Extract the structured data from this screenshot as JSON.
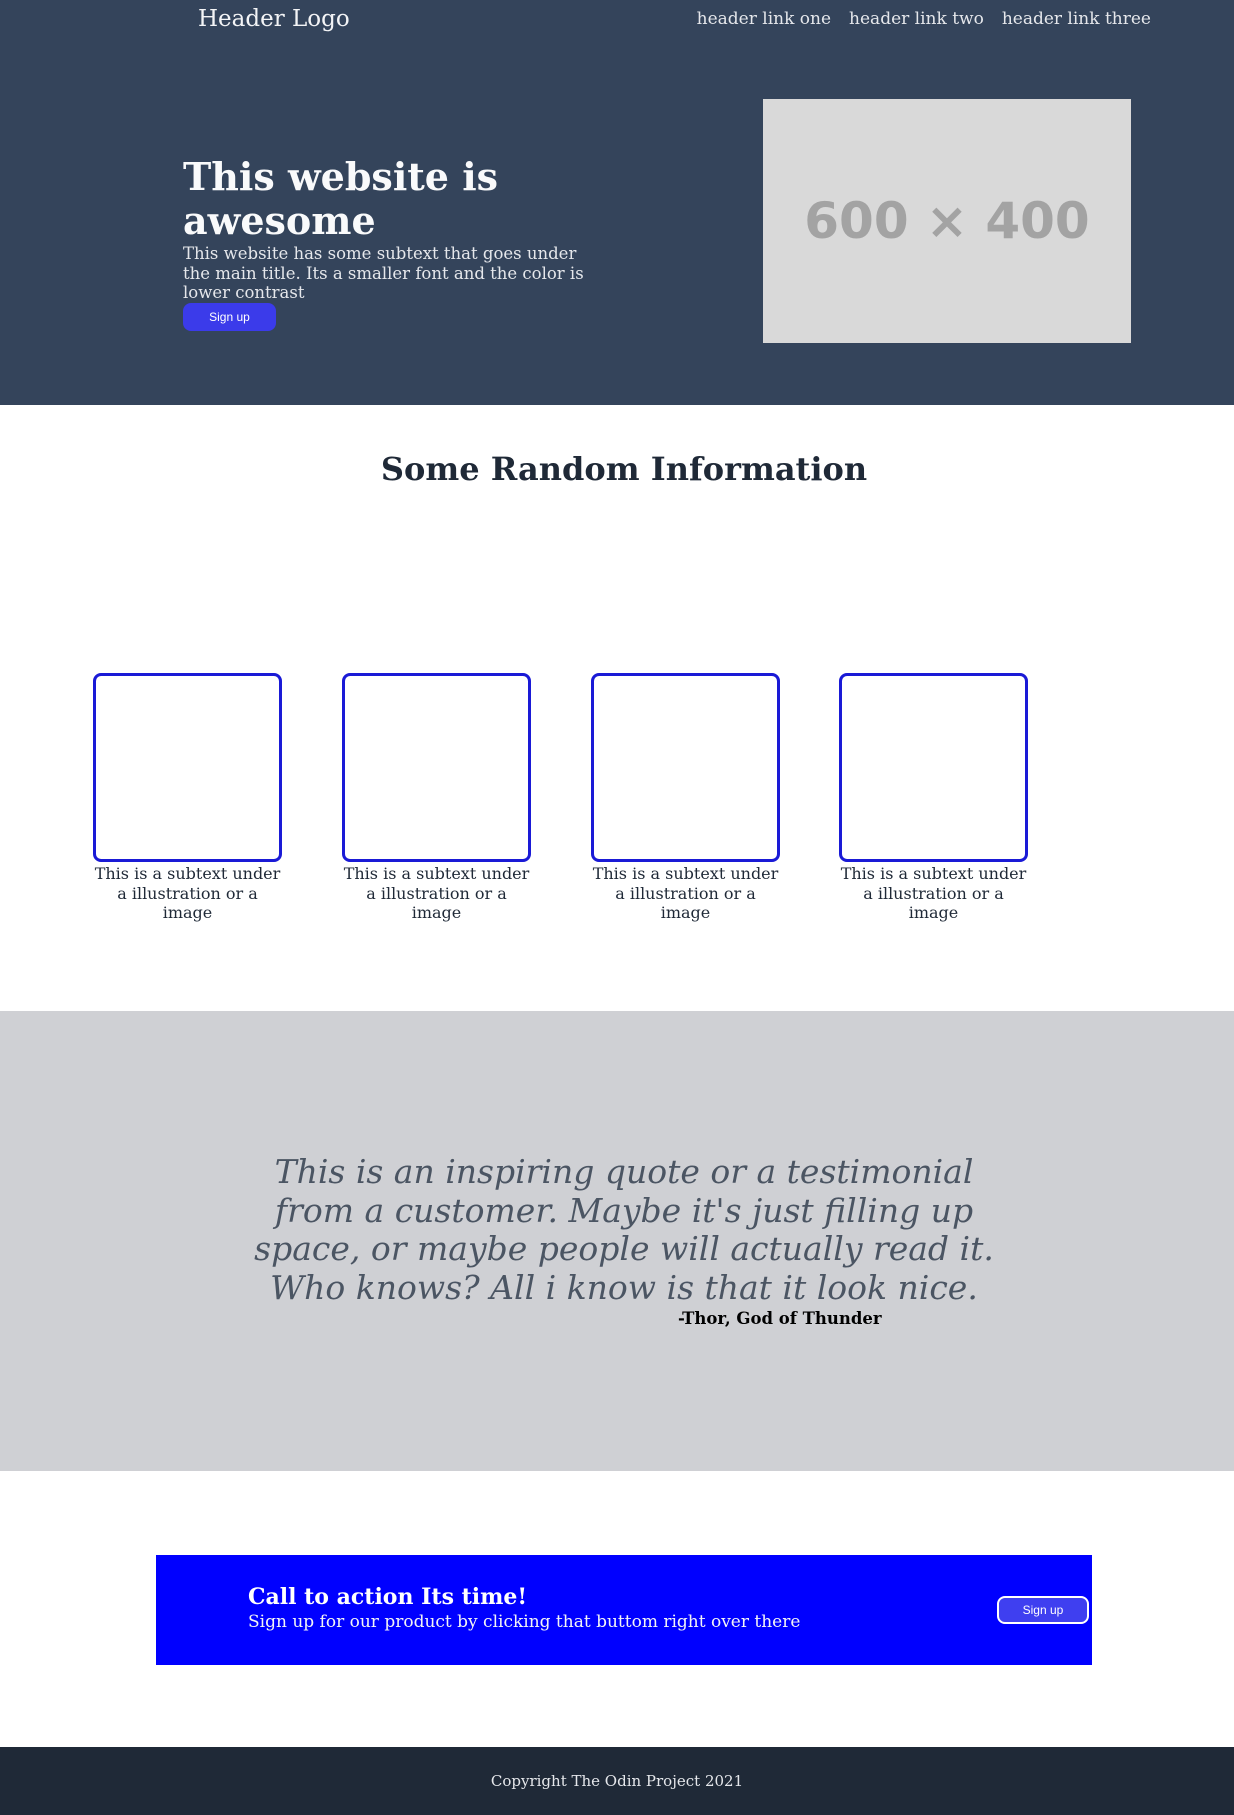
{
  "header": {
    "logo": "Header Logo",
    "links": [
      "header link one",
      "header link two",
      "header link three"
    ]
  },
  "hero": {
    "title": "This website is awesome",
    "subtitle": "This website has some subtext that goes under the main title. Its a smaller font and the color is lower contrast",
    "button_label": "Sign up",
    "image_placeholder": "600 × 400"
  },
  "info": {
    "title": "Some Random Information",
    "cards": [
      {
        "text": "This is a subtext under a illustration or a image"
      },
      {
        "text": "This is a subtext under a illustration or a image"
      },
      {
        "text": "This is a subtext under a illustration or a image"
      },
      {
        "text": "This is a subtext under a illustration or a image"
      }
    ]
  },
  "quote": {
    "text": "This is an inspiring quote or a testimonial from a customer. Maybe it's just filling up space, or maybe people will actually read it. Who knows? All i know is that it look nice.",
    "author": "-Thor, God of Thunder"
  },
  "cta": {
    "title": "Call to action Its time!",
    "subtitle": "Sign up for our product by clicking that buttom right over there",
    "button_label": "Sign up"
  },
  "footer": {
    "text": "Copyright The Odin Project 2021"
  },
  "colors": {
    "header_bg": "#34445b",
    "button_blue": "#3b3bea",
    "card_border": "#1a1ad6",
    "quote_bg": "#cfd0d4",
    "cta_bg": "#0000ff",
    "footer_bg": "#1f2937"
  }
}
